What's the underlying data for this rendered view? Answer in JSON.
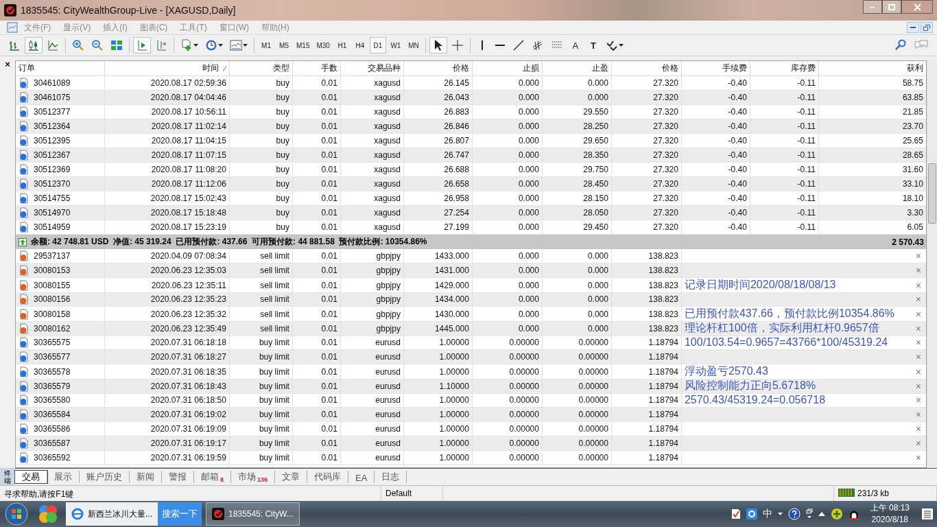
{
  "window": {
    "title": "1835545: CityWealthGroup-Live - [XAGUSD,Daily]"
  },
  "menu": [
    "文件(F)",
    "显示(V)",
    "插入(I)",
    "图表(C)",
    "工具(T)",
    "窗口(W)",
    "帮助(H)"
  ],
  "timeframes": [
    {
      "label": "M1",
      "selected": false
    },
    {
      "label": "M5",
      "selected": false
    },
    {
      "label": "M15",
      "selected": false
    },
    {
      "label": "M30",
      "selected": false
    },
    {
      "label": "H1",
      "selected": false
    },
    {
      "label": "H4",
      "selected": false
    },
    {
      "label": "D1",
      "selected": true
    },
    {
      "label": "W1",
      "selected": false
    },
    {
      "label": "MN",
      "selected": false
    }
  ],
  "text_tools": [
    "A",
    "T"
  ],
  "terminal": {
    "caption": "终端",
    "close": "×",
    "columns": [
      "订单",
      "时间",
      "类型",
      "手数",
      "交易品种",
      "价格",
      "止损",
      "止盈",
      "价格",
      "手续费",
      "库存费",
      "获利"
    ],
    "positions": [
      {
        "order": "30461089",
        "time": "2020.08.17 02:59:36",
        "type": "buy",
        "lots": "0.01",
        "symbol": "xagusd",
        "price": "26.145",
        "sl": "0.000",
        "tp": "0.000",
        "current": "27.320",
        "commission": "-0.40",
        "swap": "-0.11",
        "profit": "58.75"
      },
      {
        "order": "30461075",
        "time": "2020.08.17 04:04:46",
        "type": "buy",
        "lots": "0.01",
        "symbol": "xagusd",
        "price": "26.043",
        "sl": "0.000",
        "tp": "0.000",
        "current": "27.320",
        "commission": "-0.40",
        "swap": "-0.11",
        "profit": "63.85"
      },
      {
        "order": "30512377",
        "time": "2020.08.17 10:56:11",
        "type": "buy",
        "lots": "0.01",
        "symbol": "xagusd",
        "price": "26.883",
        "sl": "0.000",
        "tp": "29.550",
        "current": "27.320",
        "commission": "-0.40",
        "swap": "-0.11",
        "profit": "21.85"
      },
      {
        "order": "30512364",
        "time": "2020.08.17 11:02:14",
        "type": "buy",
        "lots": "0.01",
        "symbol": "xagusd",
        "price": "26.846",
        "sl": "0.000",
        "tp": "28.250",
        "current": "27.320",
        "commission": "-0.40",
        "swap": "-0.11",
        "profit": "23.70"
      },
      {
        "order": "30512395",
        "time": "2020.08.17 11:04:15",
        "type": "buy",
        "lots": "0.01",
        "symbol": "xagusd",
        "price": "26.807",
        "sl": "0.000",
        "tp": "29.650",
        "current": "27.320",
        "commission": "-0.40",
        "swap": "-0.11",
        "profit": "25.65"
      },
      {
        "order": "30512367",
        "time": "2020.08.17 11:07:15",
        "type": "buy",
        "lots": "0.01",
        "symbol": "xagusd",
        "price": "26.747",
        "sl": "0.000",
        "tp": "28.350",
        "current": "27.320",
        "commission": "-0.40",
        "swap": "-0.11",
        "profit": "28.65"
      },
      {
        "order": "30512369",
        "time": "2020.08.17 11:08:20",
        "type": "buy",
        "lots": "0.01",
        "symbol": "xagusd",
        "price": "26.688",
        "sl": "0.000",
        "tp": "29.750",
        "current": "27.320",
        "commission": "-0.40",
        "swap": "-0.11",
        "profit": "31.60"
      },
      {
        "order": "30512370",
        "time": "2020.08.17 11:12:06",
        "type": "buy",
        "lots": "0.01",
        "symbol": "xagusd",
        "price": "26.658",
        "sl": "0.000",
        "tp": "28.450",
        "current": "27.320",
        "commission": "-0.40",
        "swap": "-0.11",
        "profit": "33.10"
      },
      {
        "order": "30514755",
        "time": "2020.08.17 15:02:43",
        "type": "buy",
        "lots": "0.01",
        "symbol": "xagusd",
        "price": "26.958",
        "sl": "0.000",
        "tp": "28.150",
        "current": "27.320",
        "commission": "-0.40",
        "swap": "-0.11",
        "profit": "18.10"
      },
      {
        "order": "30514970",
        "time": "2020.08.17 15:18:48",
        "type": "buy",
        "lots": "0.01",
        "symbol": "xagusd",
        "price": "27.254",
        "sl": "0.000",
        "tp": "28.050",
        "current": "27.320",
        "commission": "-0.40",
        "swap": "-0.11",
        "profit": "3.30"
      },
      {
        "order": "30514959",
        "time": "2020.08.17 15:23:19",
        "type": "buy",
        "lots": "0.01",
        "symbol": "xagusd",
        "price": "27.199",
        "sl": "0.000",
        "tp": "29.450",
        "current": "27.320",
        "commission": "-0.40",
        "swap": "-0.11",
        "profit": "6.05"
      }
    ],
    "summary": {
      "text": "余额: 42 748.81 USD  净值: 45 319.24  已用预付款: 437.66  可用预付款: 44 881.58  预付款比例: 10354.86%",
      "profit": "2 570.43"
    },
    "orders": [
      {
        "order": "29537137",
        "time": "2020.04.09 07:08:34",
        "type": "sell limit",
        "lots": "0.01",
        "symbol": "gbpjpy",
        "price": "1433.000",
        "sl": "0.000",
        "tp": "0.000",
        "current": "138.823",
        "color": "#e0601e",
        "cancel": "×"
      },
      {
        "order": "30080153",
        "time": "2020.06.23 12:35:03",
        "type": "sell limit",
        "lots": "0.01",
        "symbol": "gbpjpy",
        "price": "1431.000",
        "sl": "0.000",
        "tp": "0.000",
        "current": "138.823",
        "color": "#e0601e",
        "cancel": "×"
      },
      {
        "order": "30080155",
        "time": "2020.06.23 12:35:11",
        "type": "sell limit",
        "lots": "0.01",
        "symbol": "gbpjpy",
        "price": "1429.000",
        "sl": "0.000",
        "tp": "0.000",
        "current": "138.823",
        "color": "#e0601e",
        "cancel": "×",
        "note": "记录日期时间2020/08/18/08/13"
      },
      {
        "order": "30080156",
        "time": "2020.06.23 12:35:23",
        "type": "sell limit",
        "lots": "0.01",
        "symbol": "gbpjpy",
        "price": "1434.000",
        "sl": "0.000",
        "tp": "0.000",
        "current": "138.823",
        "color": "#e0601e",
        "cancel": "×"
      },
      {
        "order": "30080158",
        "time": "2020.06.23 12:35:32",
        "type": "sell limit",
        "lots": "0.01",
        "symbol": "gbpjpy",
        "price": "1430.000",
        "sl": "0.000",
        "tp": "0.000",
        "current": "138.823",
        "color": "#e0601e",
        "cancel": "×",
        "note": "已用预付款437.66，预付款比例10354.86%"
      },
      {
        "order": "30080162",
        "time": "2020.06.23 12:35:49",
        "type": "sell limit",
        "lots": "0.01",
        "symbol": "gbpjpy",
        "price": "1445.000",
        "sl": "0.000",
        "tp": "0.000",
        "current": "138.823",
        "color": "#e0601e",
        "cancel": "×",
        "note": "理论杆杠100倍，实际利用杠杆0.9657倍"
      },
      {
        "order": "30365575",
        "time": "2020.07.31 06:18:18",
        "type": "buy limit",
        "lots": "0.01",
        "symbol": "eurusd",
        "price": "1.00000",
        "sl": "0.00000",
        "tp": "0.00000",
        "current": "1.18794",
        "color": "#2a6fd6",
        "cancel": "×",
        "note": "100/103.54=0.9657=43766*100/45319.24"
      },
      {
        "order": "30365577",
        "time": "2020.07.31 06:18:27",
        "type": "buy limit",
        "lots": "0.01",
        "symbol": "eurusd",
        "price": "1.00000",
        "sl": "0.00000",
        "tp": "0.00000",
        "current": "1.18794",
        "color": "#2a6fd6",
        "cancel": "×"
      },
      {
        "order": "30365578",
        "time": "2020.07.31 06:18:35",
        "type": "buy limit",
        "lots": "0.01",
        "symbol": "eurusd",
        "price": "1.00000",
        "sl": "0.00000",
        "tp": "0.00000",
        "current": "1.18794",
        "color": "#2a6fd6",
        "cancel": "×",
        "note": "浮动盈亏2570.43"
      },
      {
        "order": "30365579",
        "time": "2020.07.31 06:18:43",
        "type": "buy limit",
        "lots": "0.01",
        "symbol": "eurusd",
        "price": "1.10000",
        "sl": "0.00000",
        "tp": "0.00000",
        "current": "1.18794",
        "color": "#2a6fd6",
        "cancel": "×",
        "note": "风险控制能力正向5.6718%"
      },
      {
        "order": "30365580",
        "time": "2020.07.31 06:18:50",
        "type": "buy limit",
        "lots": "0.01",
        "symbol": "eurusd",
        "price": "1.00000",
        "sl": "0.00000",
        "tp": "0.00000",
        "current": "1.18794",
        "color": "#2a6fd6",
        "cancel": "×",
        "note": "2570.43/45319.24=0.056718"
      },
      {
        "order": "30365584",
        "time": "2020.07.31 06:19:02",
        "type": "buy limit",
        "lots": "0.01",
        "symbol": "eurusd",
        "price": "1.00000",
        "sl": "0.00000",
        "tp": "0.00000",
        "current": "1.18794",
        "color": "#2a6fd6",
        "cancel": "×"
      },
      {
        "order": "30365586",
        "time": "2020.07.31 06:19:09",
        "type": "buy limit",
        "lots": "0.01",
        "symbol": "eurusd",
        "price": "1.00000",
        "sl": "0.00000",
        "tp": "0.00000",
        "current": "1.18794",
        "color": "#2a6fd6",
        "cancel": "×"
      },
      {
        "order": "30365587",
        "time": "2020.07.31 06:19:17",
        "type": "buy limit",
        "lots": "0.01",
        "symbol": "eurusd",
        "price": "1.00000",
        "sl": "0.00000",
        "tp": "0.00000",
        "current": "1.18794",
        "color": "#2a6fd6",
        "cancel": "×"
      },
      {
        "order": "30365592",
        "time": "2020.07.31 06:19:59",
        "type": "buy limit",
        "lots": "0.01",
        "symbol": "eurusd",
        "price": "1.00000",
        "sl": "0.00000",
        "tp": "0.00000",
        "current": "1.18794",
        "color": "#2a6fd6",
        "cancel": "×"
      }
    ]
  },
  "tabs": [
    {
      "label": "交易",
      "selected": true
    },
    {
      "label": "展示",
      "selected": false
    },
    {
      "label": "账户历史",
      "selected": false
    },
    {
      "label": "新闻",
      "selected": false
    },
    {
      "label": "警报",
      "selected": false
    },
    {
      "label": "邮箱",
      "selected": false,
      "badge": "8"
    },
    {
      "label": "市场",
      "selected": false,
      "badge": "136"
    },
    {
      "label": "文章",
      "selected": false
    },
    {
      "label": "代码库",
      "selected": false
    },
    {
      "label": "EA",
      "selected": false
    },
    {
      "label": "日志",
      "selected": false
    }
  ],
  "status_bar": {
    "help": "寻求帮助,请按F1键",
    "profile": "Default",
    "traffic": "231/3 kb"
  },
  "taskbar": {
    "tasks": [
      {
        "kind": "browser",
        "label": "新西兰冰川大量...",
        "action": "搜索一下"
      },
      {
        "kind": "app",
        "label": "1835545: CityW..."
      }
    ],
    "ime": "中",
    "time": "上午 08:13",
    "date": "2020/8/18"
  }
}
